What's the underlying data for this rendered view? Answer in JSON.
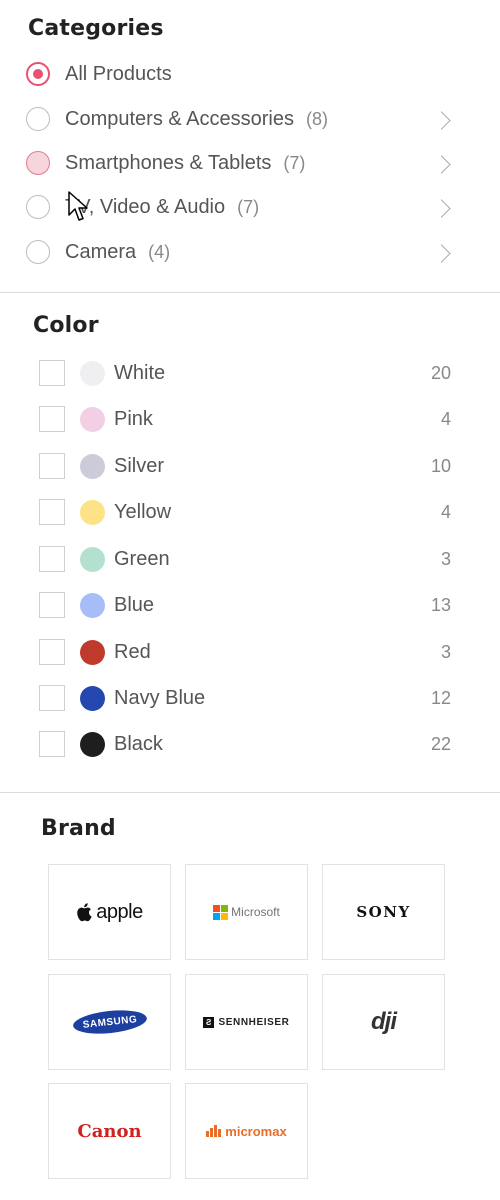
{
  "categories": {
    "title": "Categories",
    "items": [
      {
        "label": "All Products",
        "count": "",
        "state": "selected"
      },
      {
        "label": "Computers & Accessories",
        "count": "(8)",
        "state": "normal"
      },
      {
        "label": "Smartphones & Tablets",
        "count": "(7)",
        "state": "hover"
      },
      {
        "label": "TV, Video & Audio",
        "count": "(7)",
        "state": "normal"
      },
      {
        "label": "Camera",
        "count": "(4)",
        "state": "normal"
      }
    ]
  },
  "color": {
    "title": "Color",
    "items": [
      {
        "label": "White",
        "count": "20",
        "swatch": "#efeff1"
      },
      {
        "label": "Pink",
        "count": "4",
        "swatch": "#f2cfe4"
      },
      {
        "label": "Silver",
        "count": "10",
        "swatch": "#cccbd9"
      },
      {
        "label": "Yellow",
        "count": "4",
        "swatch": "#fde287"
      },
      {
        "label": "Green",
        "count": "3",
        "swatch": "#b4e1cf"
      },
      {
        "label": "Blue",
        "count": "13",
        "swatch": "#a6bdf7"
      },
      {
        "label": "Red",
        "count": "3",
        "swatch": "#c03a2b"
      },
      {
        "label": "Navy Blue",
        "count": "12",
        "swatch": "#2548b0"
      },
      {
        "label": "Black",
        "count": "22",
        "swatch": "#1e1e1e"
      }
    ]
  },
  "brand": {
    "title": "Brand",
    "items": [
      {
        "name": "apple",
        "logo_icon": "apple-logo"
      },
      {
        "name": "Microsoft",
        "logo_icon": "microsoft-logo"
      },
      {
        "name": "SONY",
        "logo_icon": "sony-logo"
      },
      {
        "name": "SAMSUNG",
        "logo_icon": "samsung-logo"
      },
      {
        "name": "SENNHEISER",
        "logo_icon": "sennheiser-logo"
      },
      {
        "name": "dji",
        "logo_icon": "dji-logo"
      },
      {
        "name": "Canon",
        "logo_icon": "canon-logo"
      },
      {
        "name": "micromax",
        "logo_icon": "micromax-logo"
      }
    ]
  },
  "colors": {
    "accent": "#e8516f",
    "microsoft": [
      "#f25022",
      "#7fba00",
      "#00a4ef",
      "#ffb900"
    ]
  },
  "cursor": {
    "icon": "arrow-cursor-icon"
  }
}
